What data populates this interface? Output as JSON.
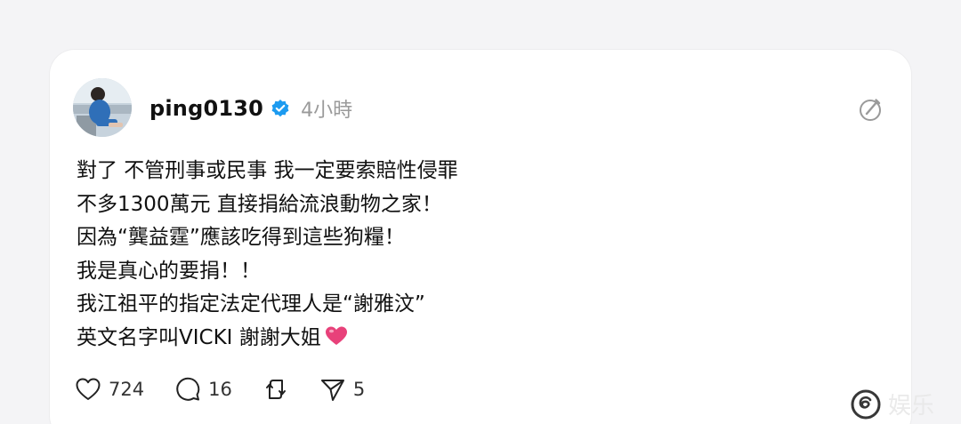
{
  "post": {
    "username": "ping0130",
    "timestamp": "4小時",
    "lines": [
      "對了 不管刑事或民事 我一定要索賠性侵罪",
      "不多1300萬元 直接捐給流浪動物之家！",
      "因為“龔益霆”應該吃得到這些狗糧！",
      "我是真心的要捐！！",
      "我江祖平的指定法定代理人是“謝雅汶”",
      "英文名字叫VICKI 謝謝大姐"
    ],
    "colors": {
      "verified": "#1d9bf0",
      "heart_emoji": "#e8417a"
    }
  },
  "actions": {
    "likes": "724",
    "comments": "16",
    "shares": "5",
    "icons": [
      "heart-icon",
      "comment-icon",
      "repost-icon",
      "send-icon"
    ]
  },
  "watermark": {
    "text": "娱乐",
    "icon": "threads-logo-icon"
  }
}
